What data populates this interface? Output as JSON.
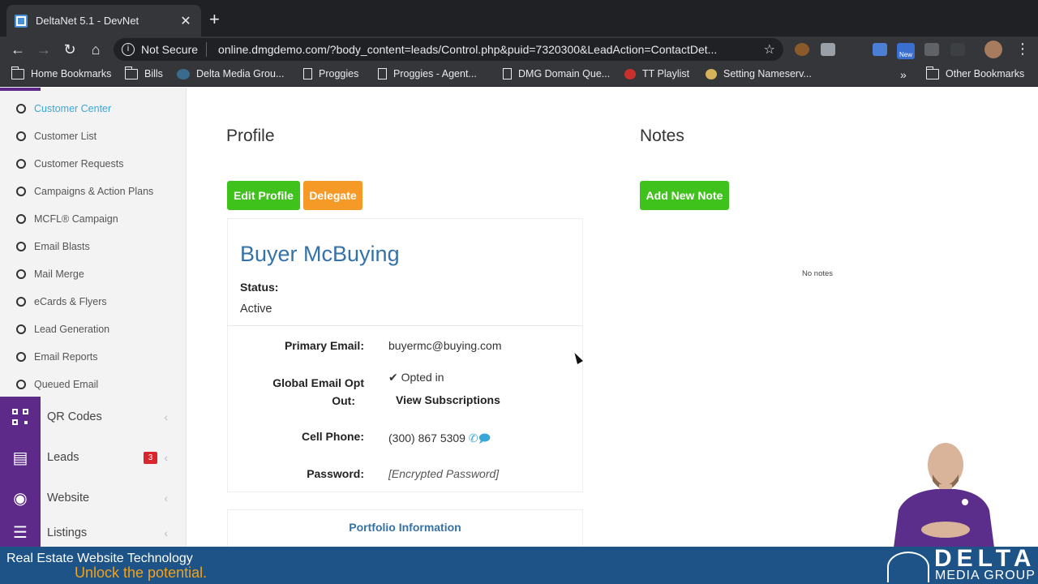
{
  "browser": {
    "tab_title": "DeltaNet 5.1 - DevNet",
    "tab_close": "✕",
    "new_tab": "+",
    "security_label": "Not Secure",
    "url": "online.dmgdemo.com/?body_content=leads/Control.php&puid=7320300&LeadAction=ContactDet...",
    "bookmarks": [
      "Home Bookmarks",
      "Bills",
      "Delta Media Grou...",
      "Proggies",
      "Proggies - Agent...",
      "DMG Domain Que...",
      "TT Playlist",
      "Setting Nameserv..."
    ],
    "bookmarks_overflow": "»",
    "other_bookmarks": "Other Bookmarks",
    "extension_badge": "New"
  },
  "sidebar": {
    "sub_items": [
      "Customer Center",
      "Customer List",
      "Customer Requests",
      "Campaigns & Action Plans",
      "MCFL® Campaign",
      "Email Blasts",
      "Mail Merge",
      "eCards & Flyers",
      "Lead Generation",
      "Email Reports",
      "Queued Email"
    ],
    "main_items": [
      {
        "label": "QR Codes",
        "icon": "qr-code-icon"
      },
      {
        "label": "Leads",
        "icon": "lead-card-icon",
        "badge": "3"
      },
      {
        "label": "Website",
        "icon": "globe-icon"
      },
      {
        "label": "Listings",
        "icon": "list-icon"
      }
    ]
  },
  "profile": {
    "section_title": "Profile",
    "edit_button": "Edit Profile",
    "delegate_button": "Delegate",
    "name": "Buyer McBuying",
    "status_label": "Status:",
    "status_value": "Active",
    "primary_email_label": "Primary Email:",
    "primary_email": "buyermc@buying.com",
    "opt_out_label_1": "Global Email Opt",
    "opt_out_label_2": "Out:",
    "opted_in": "Opted in",
    "view_subscriptions": "View Subscriptions",
    "cell_label": "Cell Phone:",
    "cell_value": "(300) 867 5309",
    "password_label": "Password:",
    "password_value": "[Encrypted Password]",
    "portfolio_link": "Portfolio Information"
  },
  "notes": {
    "section_title": "Notes",
    "add_button": "Add New Note",
    "empty_text": "No notes"
  },
  "banner": {
    "line1": "Real Estate Website Technology",
    "line2": "Unlock the potential.",
    "logo_main": "DELTA",
    "logo_sub": "MEDIA GROUP"
  },
  "colors": {
    "sidebar_accent": "#5d2a8a",
    "link_blue": "#3572a8",
    "active_cyan": "#3aa7d9",
    "green_button": "#40c21c",
    "orange_button": "#f59a26",
    "badge_red": "#d9262c",
    "banner_blue": "#1d5387",
    "banner_orange": "#f2a21b"
  }
}
